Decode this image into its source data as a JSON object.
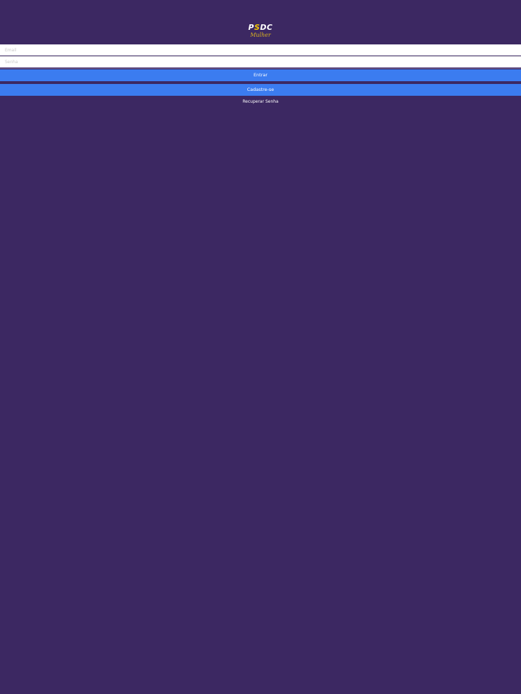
{
  "logo": {
    "main_text_pre": "P",
    "main_text_dot": "S",
    "main_text_post": "DC",
    "sub_text": "Mulher"
  },
  "login_form": {
    "email_placeholder": "Email",
    "password_placeholder": "Senha",
    "login_button_label": "Entrar",
    "register_button_label": "Cadastre-se",
    "recover_link_label": "Recuperar Senha"
  },
  "colors": {
    "background": "#3c2862",
    "button": "#3b7cf0",
    "logo_accent": "#f2c400"
  }
}
